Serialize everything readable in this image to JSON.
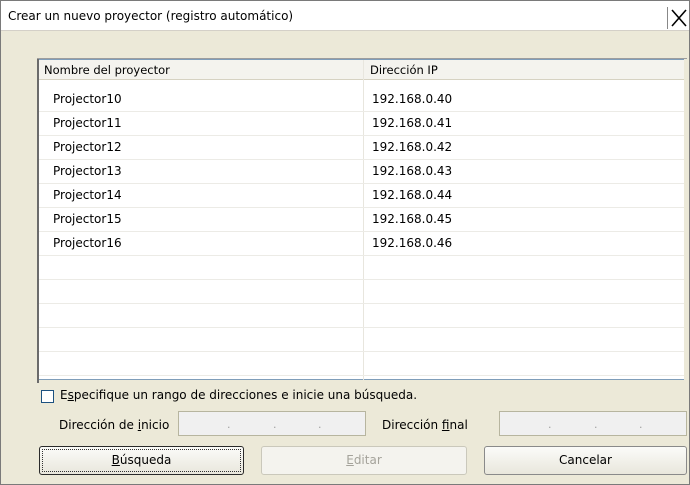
{
  "window": {
    "title": "Crear un nuevo proyector (registro automático)"
  },
  "table": {
    "columns": [
      "Nombre del proyector",
      "Dirección IP"
    ],
    "rows": [
      {
        "name": "Projector10",
        "ip": "192.168.0.40"
      },
      {
        "name": "Projector11",
        "ip": "192.168.0.41"
      },
      {
        "name": "Projector12",
        "ip": "192.168.0.42"
      },
      {
        "name": "Projector13",
        "ip": "192.168.0.43"
      },
      {
        "name": "Projector14",
        "ip": "192.168.0.44"
      },
      {
        "name": "Projector15",
        "ip": "192.168.0.45"
      },
      {
        "name": "Projector16",
        "ip": "192.168.0.46"
      }
    ]
  },
  "range": {
    "checkbox_label_pre": "E",
    "checkbox_label_u": "s",
    "checkbox_label_post": "pecifique un rango de direcciones e inicie una búsqueda.",
    "start_label_pre": "Dirección de ",
    "start_label_u": "i",
    "start_label_post": "nicio",
    "end_label_pre": "Dirección ",
    "end_label_u": "f",
    "end_label_post": "inal",
    "ip_dot": "."
  },
  "buttons": {
    "search_u": "B",
    "search_post": "úsqueda",
    "edit_u": "E",
    "edit_post": "ditar",
    "cancel": "Cancelar"
  }
}
